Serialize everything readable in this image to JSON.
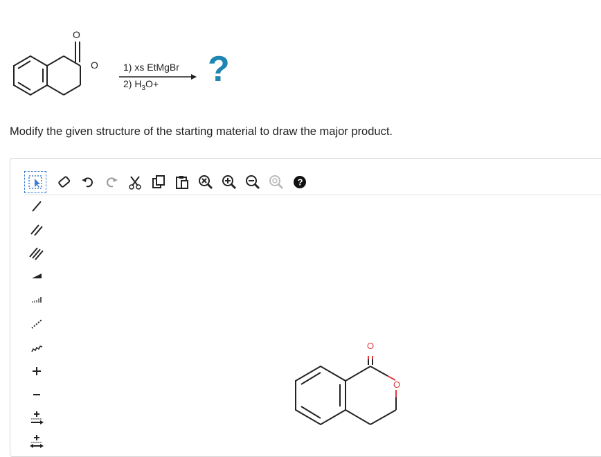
{
  "reaction": {
    "step1": "1) xs EtMgBr",
    "step2_prefix": "2) H",
    "step2_sub": "3",
    "step2_suffix": "O+",
    "question_mark": "?",
    "atom_o": "O"
  },
  "instruction": "Modify the given structure of the starting material to draw the major product.",
  "toolbar_top": [
    {
      "name": "select-lasso-icon"
    },
    {
      "name": "erase-icon"
    },
    {
      "name": "undo-icon"
    },
    {
      "name": "redo-icon"
    },
    {
      "name": "cut-icon"
    },
    {
      "name": "copy-icon"
    },
    {
      "name": "paste-icon"
    },
    {
      "name": "clean-icon"
    },
    {
      "name": "zoom-in-icon"
    },
    {
      "name": "zoom-out-icon"
    },
    {
      "name": "zoom-reset-icon"
    },
    {
      "name": "help-icon"
    }
  ],
  "toolbar_left": [
    "single-bond-icon",
    "double-bond-icon",
    "triple-bond-icon",
    "wedge-bond-icon",
    "hash-bond-icon",
    "dashed-bond-icon",
    "wavy-bond-icon",
    "positive-charge-icon",
    "negative-charge-icon",
    "electron-push-icon",
    "electron-pair-icon"
  ],
  "canvas": {
    "atom_o_carbonyl": "O",
    "atom_o_ring": "O",
    "colors": {
      "oxygen": "#e0393e",
      "bond": "#222222"
    }
  }
}
